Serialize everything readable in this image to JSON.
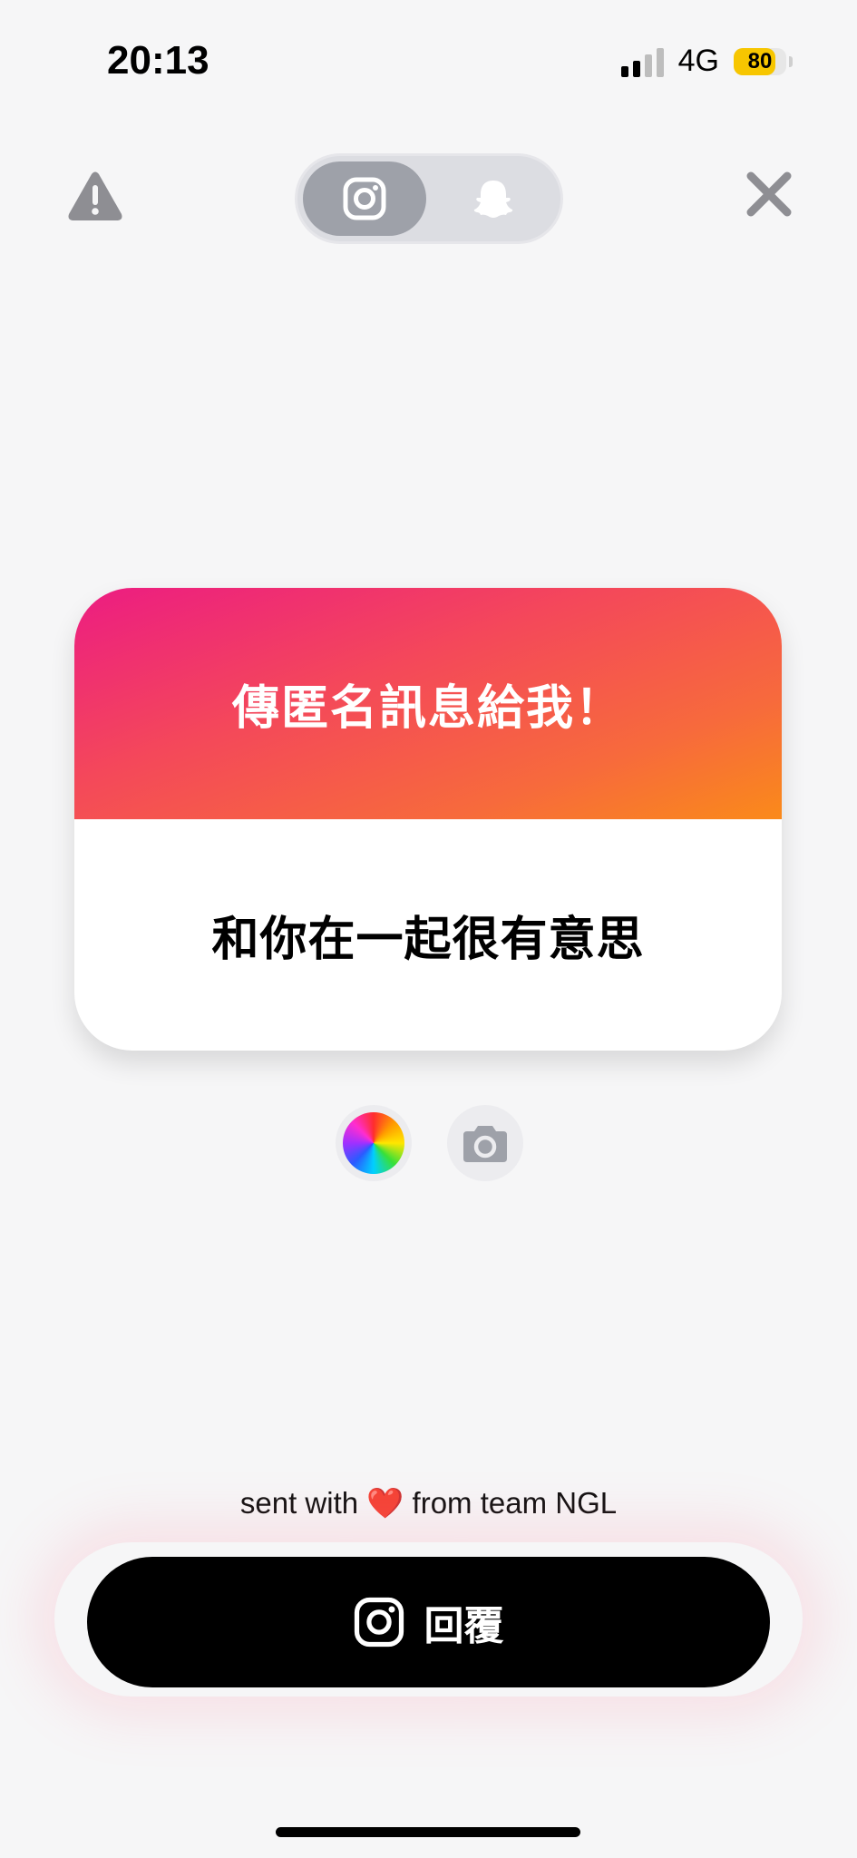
{
  "status_bar": {
    "time": "20:13",
    "network": "4G",
    "battery": "80",
    "battery_level": 0.8,
    "signal_bars_filled": 2,
    "signal_bars_total": 4
  },
  "header": {
    "left_icon": "warning-icon",
    "right_icon": "close-icon",
    "toggle_options": [
      "instagram-icon",
      "snapchat-ghost-icon"
    ],
    "toggle_selected": "instagram-icon"
  },
  "card": {
    "title": "傳匿名訊息給我！",
    "message": "和你在一起很有意思",
    "gradient_colors": [
      "#ec1c82",
      "#f4485a",
      "#f76a3c",
      "#fa8a1a"
    ]
  },
  "tools": {
    "color_icon": "color-wheel-icon",
    "camera_icon": "camera-icon"
  },
  "footer": {
    "sent_prefix": "sent with",
    "heart": "❤️",
    "sent_suffix": "from team NGL",
    "reply_label": "回覆",
    "reply_icon": "instagram-icon"
  }
}
